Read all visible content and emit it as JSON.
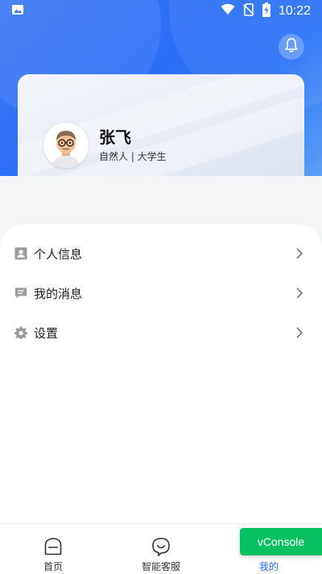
{
  "status_bar": {
    "time": "10:22",
    "icons": [
      "image-icon",
      "wifi-icon",
      "no-sim-icon",
      "battery-charging-icon"
    ]
  },
  "header": {
    "bell_icon": "bell-icon"
  },
  "profile": {
    "name": "张飞",
    "meta": "自然人 | 大学生"
  },
  "menu": {
    "items": [
      {
        "label": "个人信息",
        "icon": "person-card-icon"
      },
      {
        "label": "我的消息",
        "icon": "message-icon"
      },
      {
        "label": "设置",
        "icon": "gear-icon"
      }
    ]
  },
  "bottom_nav": {
    "items": [
      {
        "label": "首页",
        "icon": "home-icon",
        "active": false
      },
      {
        "label": "智能客服",
        "icon": "smiley-chat-icon",
        "active": false
      },
      {
        "label": "我的",
        "icon": "user-icon",
        "active": true
      }
    ]
  },
  "vconsole": {
    "label": "vConsole"
  },
  "colors": {
    "accent": "#2b6ef6",
    "vconsole": "#07c160"
  }
}
